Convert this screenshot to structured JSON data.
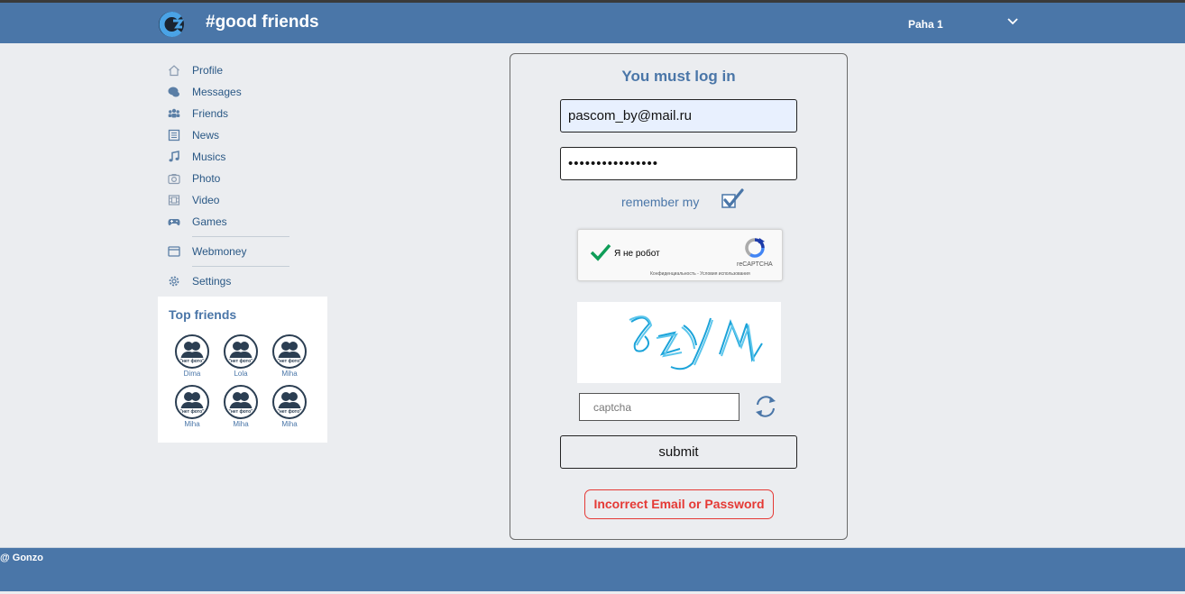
{
  "header": {
    "site_title": "#good friends",
    "user_name": "Paha 1",
    "logo_icon": "site-logo-c-icon",
    "user_menu_icon": "chevron-down-icon"
  },
  "nav": {
    "items": [
      {
        "label": "Profile",
        "icon": "home-icon"
      },
      {
        "label": "Messages",
        "icon": "chat-bubbles-icon"
      },
      {
        "label": "Friends",
        "icon": "users-icon"
      },
      {
        "label": "News",
        "icon": "newspaper-icon"
      },
      {
        "label": "Musics",
        "icon": "music-note-icon"
      },
      {
        "label": "Photo",
        "icon": "camera-icon"
      },
      {
        "label": "Video",
        "icon": "film-icon"
      },
      {
        "label": "Games",
        "icon": "gamepad-icon"
      },
      {
        "label": "Webmoney",
        "icon": "wallet-icon"
      },
      {
        "label": "Settings",
        "icon": "gear-icon"
      }
    ]
  },
  "top_friends": {
    "title": "Top friends",
    "friends": [
      {
        "name": "Dima"
      },
      {
        "name": "Lola"
      },
      {
        "name": "Miha"
      },
      {
        "name": "Miha"
      },
      {
        "name": "Miha"
      },
      {
        "name": "Miha"
      }
    ],
    "avatar_caption": "\"нет фото\""
  },
  "login": {
    "title": "You must log in",
    "email_value": "pascom_by@mail.ru",
    "password_value": "••••••••••••••••",
    "remember_label": "remember my",
    "remember_checked": true,
    "recaptcha": {
      "label": "Я не робот",
      "brand": "reCAPTCHA",
      "terms": "Конфиденциальность - Условия использования",
      "checked": true
    },
    "captcha_image_text": "8zYM",
    "captcha_placeholder": "captcha",
    "submit_label": "submit",
    "error_message": "Incorrect Email or Password"
  },
  "footer": {
    "text": "@ Gonzo"
  },
  "colors": {
    "brand_blue": "#4a76a8",
    "link_blue": "#2a5885",
    "error_red": "#e53935",
    "page_bg": "#ebedf0"
  }
}
